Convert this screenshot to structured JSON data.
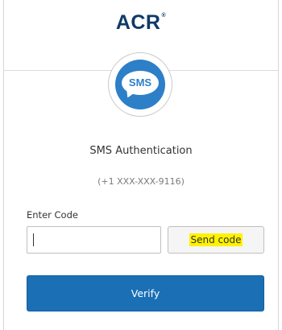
{
  "brand": {
    "logo_text": "ACR",
    "trademark": "®",
    "color": "#0f3a66"
  },
  "factor": {
    "icon_label": "SMS",
    "icon_name": "sms-bubble-icon",
    "accent": "#2d7fc8"
  },
  "heading": "SMS Authentication",
  "phone": "(+1 XXX-XXX-9116)",
  "form": {
    "code_label": "Enter Code",
    "code_value": "",
    "send_label": "Send code",
    "verify_label": "Verify",
    "verify_color": "#1a6fb5",
    "highlight_color": "#fff200"
  }
}
